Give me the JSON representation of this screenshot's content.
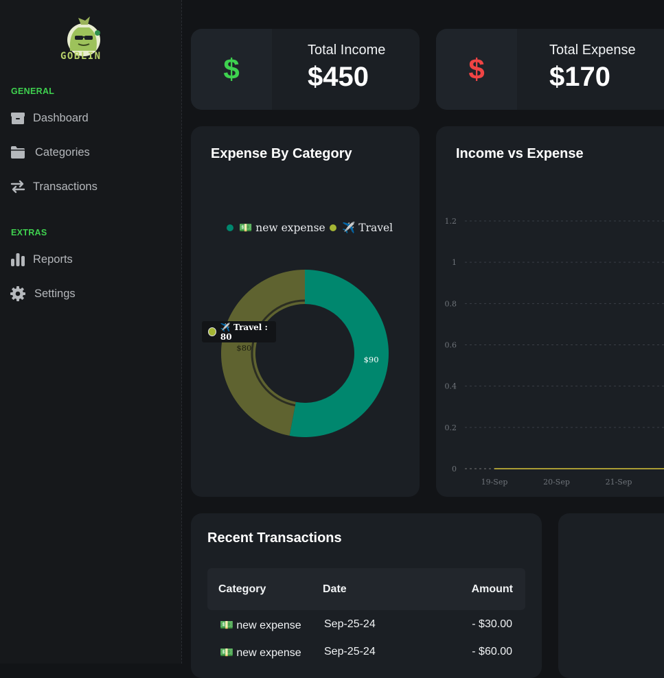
{
  "brand": {
    "name": "GOBLIN"
  },
  "sidebar": {
    "sections": [
      {
        "label": "GENERAL",
        "items": [
          {
            "label": "Dashboard",
            "icon": "box-icon"
          },
          {
            "label": "Categories",
            "icon": "folder-icon"
          },
          {
            "label": "Transactions",
            "icon": "swap-arrows-icon"
          }
        ]
      },
      {
        "label": "EXTRAS",
        "items": [
          {
            "label": "Reports",
            "icon": "bar-chart-icon"
          },
          {
            "label": "Settings",
            "icon": "gear-icon"
          }
        ]
      }
    ]
  },
  "stats": {
    "income": {
      "title": "Total Income",
      "value": "$450",
      "symbol": "$",
      "color": "#3ed14f"
    },
    "expense": {
      "title": "Total Expense",
      "value": "$170",
      "symbol": "$",
      "color": "#ef4444"
    }
  },
  "colors": {
    "accent_green": "#3fd14f",
    "card_bg": "#1b1f24",
    "teal": "#00876e",
    "olive": "#5f6330"
  },
  "chart_data": [
    {
      "type": "pie",
      "title": "Expense By Category",
      "legend": [
        "💵 new expense",
        "✈️ Travel"
      ],
      "legend_position": "top",
      "slices": [
        {
          "name": "💵 new expense",
          "value": 90,
          "label": "$90",
          "color": "#00876e",
          "legend_color": "#00876e"
        },
        {
          "name": "✈️ Travel",
          "value": 80,
          "label": "$80",
          "color": "#5f6330",
          "legend_color": "#a4b534"
        }
      ],
      "tooltip": {
        "text": "✈️ Travel : 80"
      }
    },
    {
      "type": "line",
      "title": "Income vs Expense",
      "x": [
        "19-Sep",
        "20-Sep",
        "21-Sep"
      ],
      "ylim": [
        0,
        1.2
      ],
      "yticks": [
        "0",
        "0.2",
        "0.4",
        "0.6",
        "0.8",
        "1",
        "1.2"
      ],
      "grid": true
    }
  ],
  "transactions": {
    "title": "Recent Transactions",
    "columns": [
      "Category",
      "Date",
      "Amount"
    ],
    "rows": [
      {
        "category": "💵 new expense",
        "date": "Sep-25-24",
        "amount": "- $30.00"
      },
      {
        "category": "💵 new expense",
        "date": "Sep-25-24",
        "amount": "- $60.00"
      }
    ]
  }
}
